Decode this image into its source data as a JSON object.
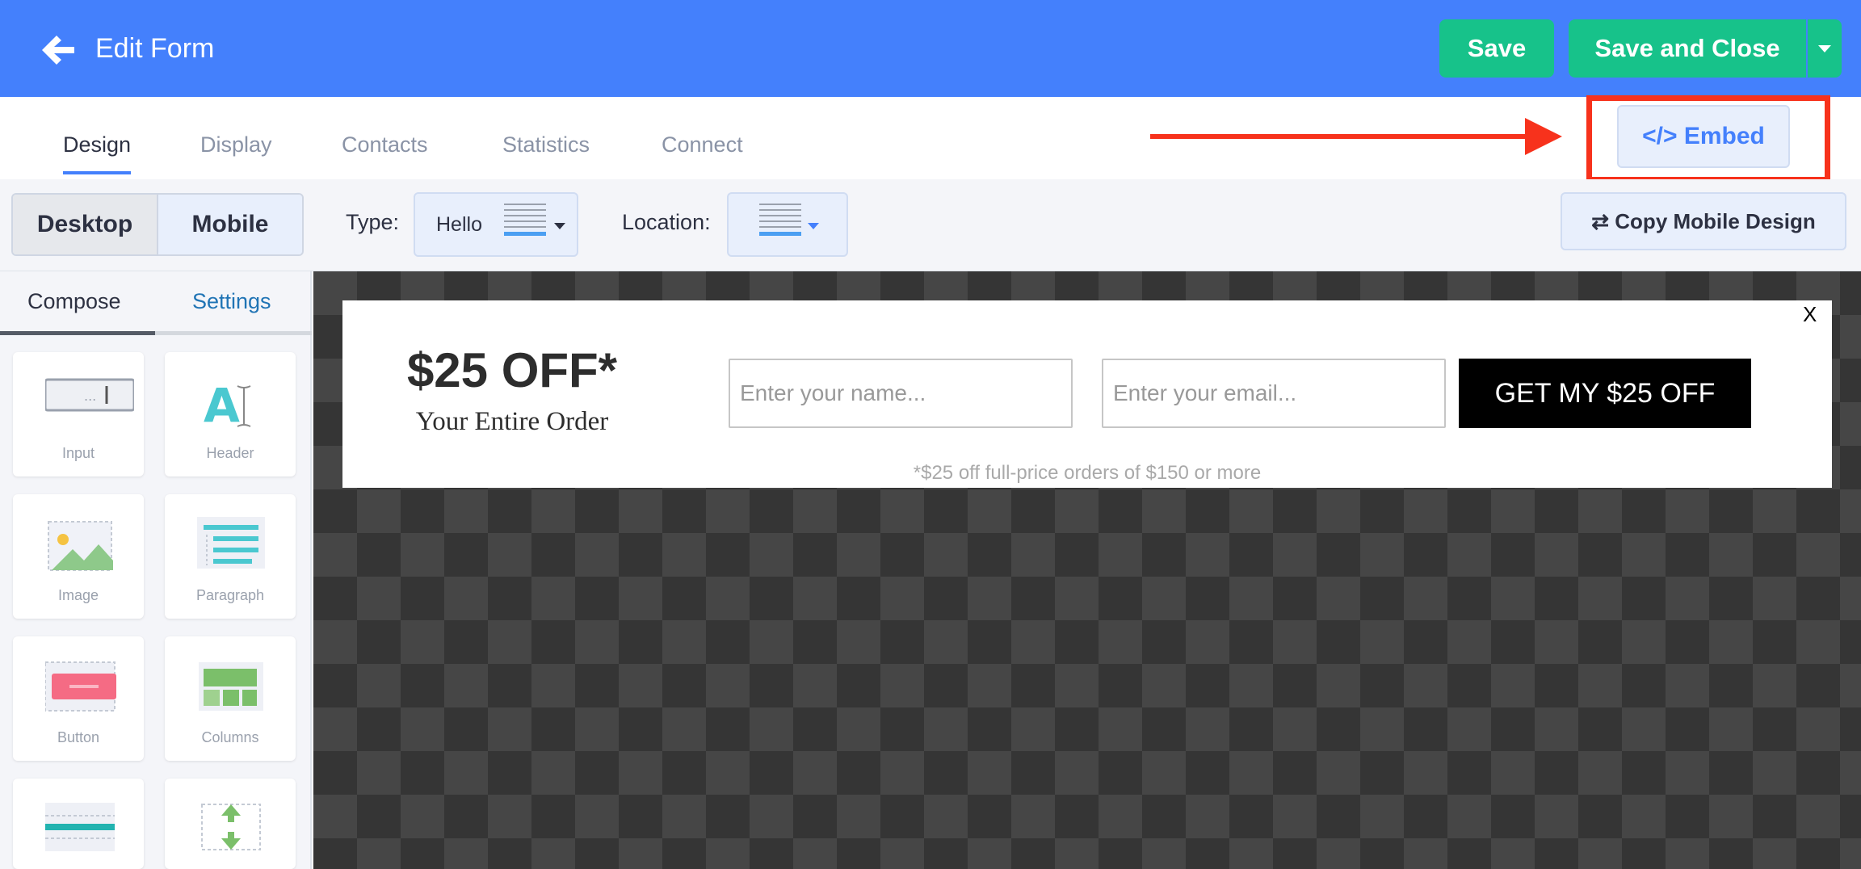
{
  "header": {
    "title": "Edit Form",
    "back_icon": "arrow-left-icon",
    "save_label": "Save",
    "save_close_label": "Save and Close",
    "color": "#4480fc",
    "button_color": "#17c28a"
  },
  "tabs": {
    "items": [
      {
        "label": "Design",
        "active": true
      },
      {
        "label": "Display"
      },
      {
        "label": "Contacts"
      },
      {
        "label": "Statistics"
      },
      {
        "label": "Connect"
      }
    ],
    "embed_label": "</> Embed",
    "annotation_color": "#f7321c"
  },
  "toolbar": {
    "desktop_label": "Desktop",
    "mobile_label": "Mobile",
    "type_label": "Type:",
    "type_value": "Hello",
    "location_label": "Location:",
    "copy_label": "⇄ Copy Mobile Design"
  },
  "panel": {
    "compose_label": "Compose",
    "settings_label": "Settings",
    "tiles": [
      {
        "label": "Input",
        "icon": "input-field-icon"
      },
      {
        "label": "Header",
        "icon": "header-text-icon"
      },
      {
        "label": "Image",
        "icon": "image-icon"
      },
      {
        "label": "Paragraph",
        "icon": "paragraph-icon"
      },
      {
        "label": "Button",
        "icon": "button-icon"
      },
      {
        "label": "Columns",
        "icon": "columns-icon"
      },
      {
        "label": "",
        "icon": "divider-icon"
      },
      {
        "label": "",
        "icon": "spacer-icon"
      }
    ]
  },
  "popup": {
    "headline": "$25 OFF*",
    "subline": "Your Entire Order",
    "name_placeholder": "Enter your name...",
    "email_placeholder": "Enter your email...",
    "button_label": "GET MY $25 OFF",
    "disclaimer": "*$25 off full-price orders of $150 or more",
    "close_label": "X"
  }
}
